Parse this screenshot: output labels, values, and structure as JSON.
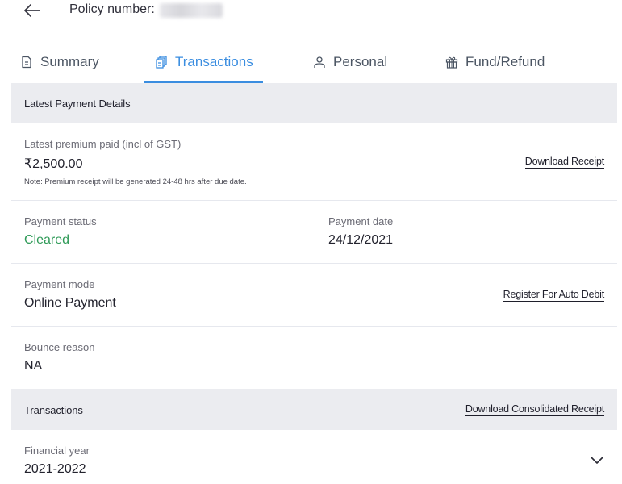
{
  "header": {
    "back_icon": "arrow-left-icon",
    "policy_label": "Policy number:",
    "policy_value_redacted": true
  },
  "tabs": [
    {
      "label": "Summary",
      "icon": "document-icon",
      "active": false
    },
    {
      "label": "Transactions",
      "icon": "stacked-documents-icon",
      "active": true
    },
    {
      "label": "Personal",
      "icon": "user-icon",
      "active": false
    },
    {
      "label": "Fund/Refund",
      "icon": "gift-icon",
      "active": false
    }
  ],
  "latest_payment": {
    "section_title": "Latest Payment Details",
    "premium_label": "Latest premium paid (incl of GST)",
    "premium_value": "₹2,500.00",
    "note": "Note: Premium receipt will be generated 24-48 hrs after due date.",
    "download_receipt": "Download Receipt",
    "status_label": "Payment status",
    "status_value": "Cleared",
    "date_label": "Payment date",
    "date_value": "24/12/2021",
    "mode_label": "Payment mode",
    "mode_value": "Online Payment",
    "auto_debit": "Register For Auto Debit",
    "bounce_label": "Bounce reason",
    "bounce_value": "NA"
  },
  "transactions": {
    "section_title": "Transactions",
    "download_consolidated": "Download Consolidated Receipt",
    "fy_label": "Financial year",
    "fy_value": "2021-2022",
    "dropdown_icon": "chevron-down-icon"
  },
  "colors": {
    "accent": "#3a8de0",
    "status_green": "#2e9a57",
    "section_bg": "#ebecf0"
  }
}
